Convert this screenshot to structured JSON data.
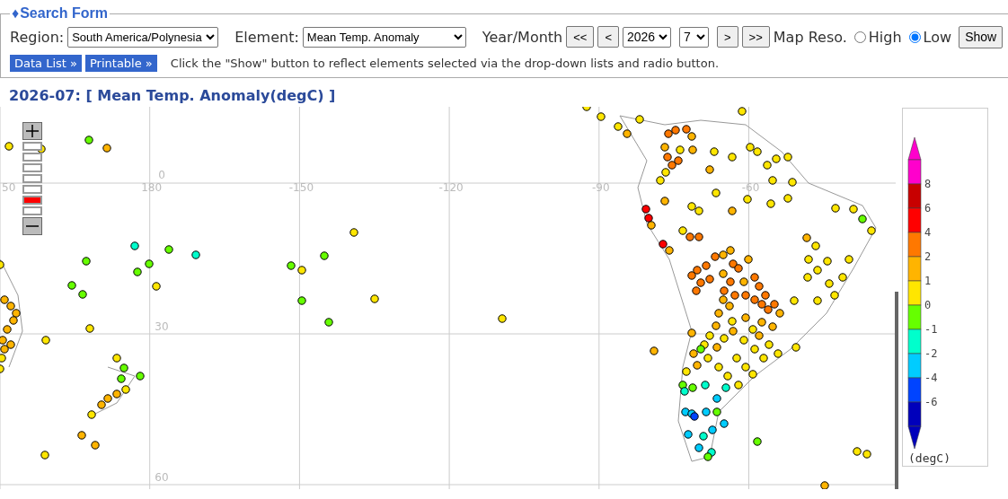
{
  "search_form": {
    "legend_icon": "♦",
    "title": "Search Form",
    "region": {
      "label": "Region:",
      "value": "South America/Polynesia"
    },
    "element": {
      "label": "Element:",
      "value": "Mean Temp. Anomaly"
    },
    "year_month": {
      "label": "Year/Month",
      "buttons_before": [
        "<<",
        "<"
      ],
      "year": "2026",
      "month": "7",
      "buttons_after": [
        ">",
        ">>"
      ]
    },
    "map_resolution": {
      "label": "Map Reso.",
      "options": [
        {
          "label": "High",
          "selected": false
        },
        {
          "label": "Low",
          "selected": true
        }
      ]
    },
    "show_button": "Show",
    "links": [
      "Data List »",
      "Printable »"
    ],
    "note": "Click the \"Show\" button to reflect elements selected via the drop-down lists and radio button."
  },
  "map_title": "2026-07: [ Mean Temp. Anomaly(degC) ]",
  "map": {
    "zoom_levels": [
      {
        "selected": false
      },
      {
        "selected": false
      },
      {
        "selected": false
      },
      {
        "selected": false
      },
      {
        "selected": false
      },
      {
        "selected": true
      },
      {
        "selected": false
      }
    ],
    "longitude_labels": [
      "50",
      "180",
      "-150",
      "-120",
      "-90",
      "-60"
    ],
    "latitude_labels": [
      "0",
      "30",
      "60"
    ]
  },
  "colorbar": {
    "bins": [
      {
        "color": "#ff00cc"
      },
      {
        "color": "#c80000"
      },
      {
        "color": "#ff0000"
      },
      {
        "color": "#ff7800"
      },
      {
        "color": "#ffb400"
      },
      {
        "color": "#ffe600"
      },
      {
        "color": "#66ff00"
      },
      {
        "color": "#00ffcc"
      },
      {
        "color": "#00ccff"
      },
      {
        "color": "#0044ff"
      },
      {
        "color": "#0000bb"
      }
    ],
    "ticks": [
      "8",
      "6",
      "4",
      "2",
      "1",
      "0",
      "-1",
      "-2",
      "-4",
      "-6"
    ],
    "unit": "(degC)"
  }
}
